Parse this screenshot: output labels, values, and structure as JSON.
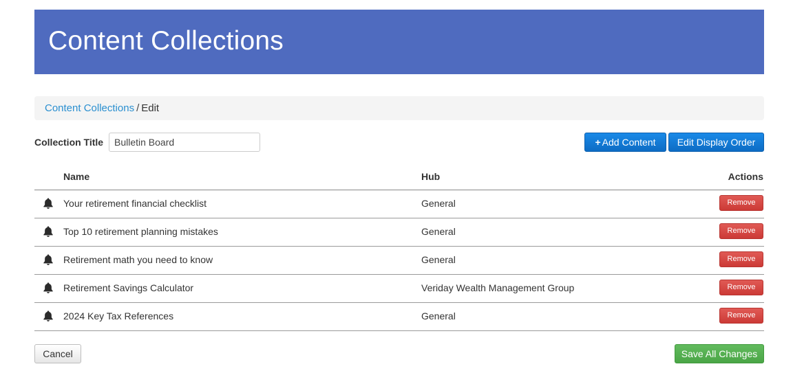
{
  "header": {
    "title": "Content Collections"
  },
  "breadcrumb": {
    "link_label": "Content Collections",
    "separator": "/",
    "current": "Edit"
  },
  "form": {
    "title_label": "Collection Title",
    "title_value": "Bulletin Board"
  },
  "toolbar": {
    "add_content_icon": "+",
    "add_content_label": "Add Content",
    "edit_order_label": "Edit Display Order"
  },
  "table": {
    "columns": {
      "name": "Name",
      "hub": "Hub",
      "actions": "Actions"
    },
    "row_icon": "bell-icon",
    "remove_label": "Remove",
    "rows": [
      {
        "name": "Your retirement financial checklist",
        "hub": "General"
      },
      {
        "name": "Top 10 retirement planning mistakes",
        "hub": "General"
      },
      {
        "name": "Retirement math you need to know",
        "hub": "General"
      },
      {
        "name": "Retirement Savings Calculator",
        "hub": "Veriday Wealth Management Group"
      },
      {
        "name": "2024 Key Tax References",
        "hub": "General"
      }
    ]
  },
  "footer": {
    "cancel_label": "Cancel",
    "save_label": "Save All Changes"
  },
  "colors": {
    "header_bg": "#4f6bbf",
    "primary": "#1a7fd6",
    "danger": "#d9534f",
    "success": "#5cb85c",
    "link": "#2a8fd0"
  }
}
